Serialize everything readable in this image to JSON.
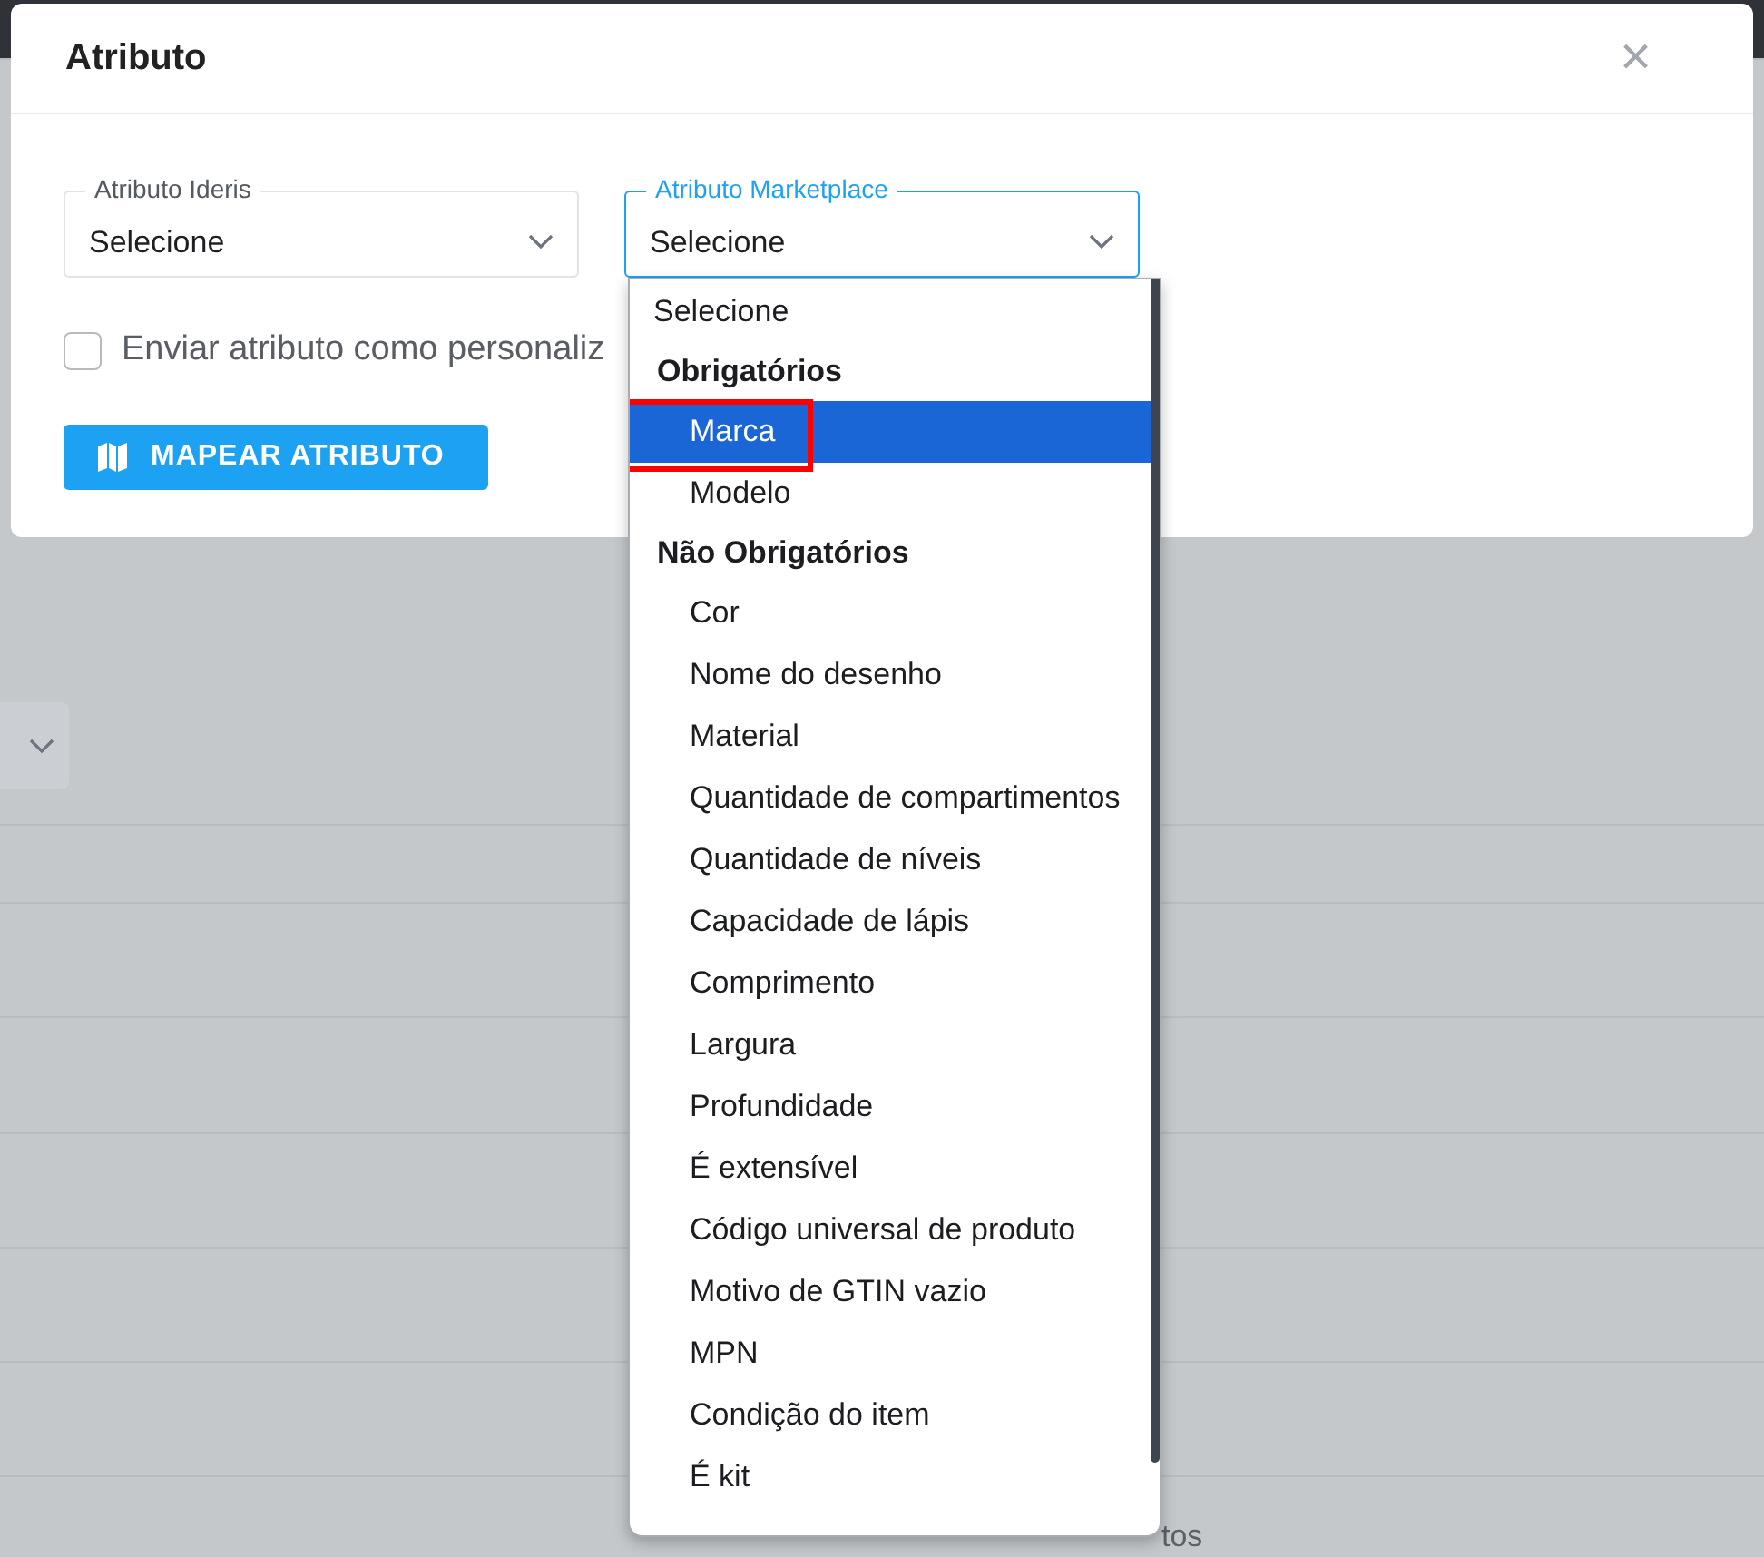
{
  "dialog": {
    "title": "Atributo",
    "close": "×",
    "fields": [
      {
        "label": "Atributo Ideris",
        "value": "Selecione",
        "focused": false
      },
      {
        "label": "Atributo Marketplace",
        "value": "Selecione",
        "focused": true
      }
    ],
    "checkbox": {
      "label": "Enviar atributo como personaliz",
      "checked": false
    },
    "button": "MAPEAR ATRIBUTO"
  },
  "dropdown": {
    "items": [
      {
        "kind": "option",
        "label": "Selecione",
        "selected": false,
        "highlighted": false
      },
      {
        "kind": "group",
        "label": "Obrigatórios"
      },
      {
        "kind": "suboption",
        "label": "Marca",
        "selected": true,
        "highlighted": true
      },
      {
        "kind": "suboption",
        "label": "Modelo",
        "selected": false,
        "highlighted": false
      },
      {
        "kind": "group",
        "label": "Não Obrigatórios"
      },
      {
        "kind": "suboption",
        "label": "Cor",
        "selected": false,
        "highlighted": false
      },
      {
        "kind": "suboption",
        "label": "Nome do desenho",
        "selected": false,
        "highlighted": false
      },
      {
        "kind": "suboption",
        "label": "Material",
        "selected": false,
        "highlighted": false
      },
      {
        "kind": "suboption",
        "label": "Quantidade de compartimentos",
        "selected": false,
        "highlighted": false
      },
      {
        "kind": "suboption",
        "label": "Quantidade de níveis",
        "selected": false,
        "highlighted": false
      },
      {
        "kind": "suboption",
        "label": "Capacidade de lápis",
        "selected": false,
        "highlighted": false
      },
      {
        "kind": "suboption",
        "label": "Comprimento",
        "selected": false,
        "highlighted": false
      },
      {
        "kind": "suboption",
        "label": "Largura",
        "selected": false,
        "highlighted": false
      },
      {
        "kind": "suboption",
        "label": "Profundidade",
        "selected": false,
        "highlighted": false
      },
      {
        "kind": "suboption",
        "label": "É extensível",
        "selected": false,
        "highlighted": false
      },
      {
        "kind": "suboption",
        "label": "Código universal de produto",
        "selected": false,
        "highlighted": false
      },
      {
        "kind": "suboption",
        "label": "Motivo de GTIN vazio",
        "selected": false,
        "highlighted": false
      },
      {
        "kind": "suboption",
        "label": "MPN",
        "selected": false,
        "highlighted": false
      },
      {
        "kind": "suboption",
        "label": "Condição do item",
        "selected": false,
        "highlighted": false
      },
      {
        "kind": "suboption",
        "label": "É kit",
        "selected": false,
        "highlighted": false
      }
    ]
  },
  "background": {
    "text": "tos"
  }
}
